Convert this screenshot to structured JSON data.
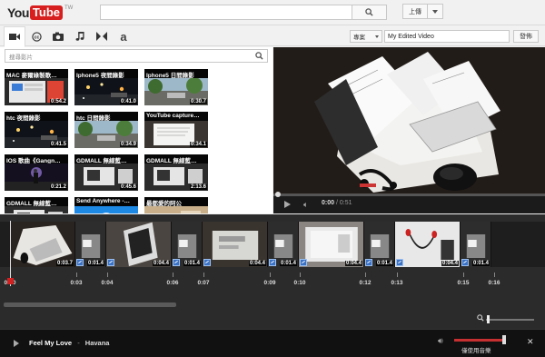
{
  "header": {
    "logo": {
      "you": "You",
      "tube": "Tube",
      "region": "TW"
    },
    "search": {
      "placeholder": ""
    },
    "upload_label": "上傳"
  },
  "toolbar": {
    "tabs": [
      {
        "name": "video",
        "glyph": "▶"
      },
      {
        "name": "creative-commons",
        "glyph": "cc"
      },
      {
        "name": "photo",
        "glyph": "▣"
      },
      {
        "name": "music",
        "glyph": "♫"
      },
      {
        "name": "transitions",
        "glyph": "⋈"
      },
      {
        "name": "text",
        "glyph": "a"
      }
    ],
    "project_label": "專案",
    "title_value": "My Edited Video",
    "publish_label": "發佈"
  },
  "library": {
    "search_placeholder": "搜尋影片",
    "clips": [
      {
        "title": "MAC 麥爾綠製歌…",
        "duration": "0:54.2",
        "scene": "desktop"
      },
      {
        "title": "Iphone5 夜間錄影",
        "duration": "0:41.0",
        "scene": "night"
      },
      {
        "title": "Iphone5 日間錄影",
        "duration": "0:30.7",
        "scene": "day"
      },
      {
        "title": "htc 夜間錄影",
        "duration": "0:41.5",
        "scene": "night"
      },
      {
        "title": "htc 日間錄影",
        "duration": "0:34.9",
        "scene": "day"
      },
      {
        "title": "YouTube capture…",
        "duration": "0:34.1",
        "scene": "paper"
      },
      {
        "title": "IOS 歌曲《Gangn…",
        "duration": "0:21.2",
        "scene": "concert"
      },
      {
        "title": "GDMALL 無線藍…",
        "duration": "0:45.6",
        "scene": "product"
      },
      {
        "title": "GDMALL 無線藍…",
        "duration": "2:13.6",
        "scene": "product"
      },
      {
        "title": "GDMALL 無線藍…",
        "duration": "",
        "scene": "product"
      },
      {
        "title": "Send Anywhere -…",
        "duration": "",
        "scene": "blue"
      },
      {
        "title": "最都愛的阿公",
        "duration": "",
        "scene": "photo"
      }
    ]
  },
  "player": {
    "current_time": "0:00",
    "duration": "0:51",
    "progress": 0
  },
  "timeline": {
    "segments": [
      {
        "duration": "0:03.7",
        "scene": "box",
        "transition": false
      },
      {
        "duration": "0:01.4",
        "scene": "dark",
        "transition": true
      },
      {
        "duration": "0:04.4",
        "scene": "phone",
        "transition": true
      },
      {
        "duration": "0:01.4",
        "scene": "dark",
        "transition": true
      },
      {
        "duration": "0:04.4",
        "scene": "box2",
        "transition": true
      },
      {
        "duration": "0:01.4",
        "scene": "dark",
        "transition": true
      },
      {
        "duration": "0:04.4",
        "scene": "phone2",
        "transition": true
      },
      {
        "duration": "0:01.4",
        "scene": "dark",
        "transition": true
      },
      {
        "duration": "0:04.4",
        "scene": "earphone",
        "transition": true
      },
      {
        "duration": "0:01.4",
        "scene": "dark",
        "transition": true
      }
    ],
    "ticks": [
      "0:00",
      "0:03",
      "0:04",
      "0:06",
      "0:07",
      "0:09",
      "0:10",
      "0:12",
      "0:13",
      "0:15",
      "0:16"
    ]
  },
  "audio": {
    "song": "Feel My Love",
    "separator": "-",
    "artist": "Havana",
    "audio_only_label": "僅使用音樂",
    "volume": 1.0
  }
}
